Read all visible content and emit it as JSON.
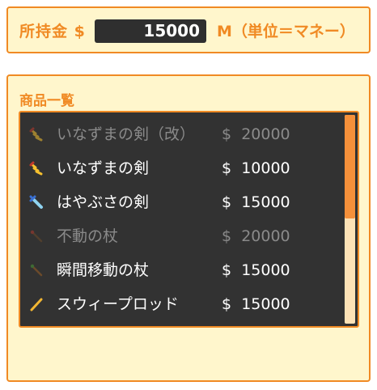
{
  "wallet": {
    "label": "所持金 $",
    "amount": "15000",
    "unit": "M（単位＝マネー）"
  },
  "shop": {
    "title": "商品一覧",
    "scroll_position": 0.0,
    "items": [
      {
        "name": "いなずまの剣（改）",
        "currency": "$",
        "price": "20000",
        "affordable": false,
        "icon": "lightning-sword-icon"
      },
      {
        "name": "いなずまの剣",
        "currency": "$",
        "price": "10000",
        "affordable": true,
        "icon": "lightning-sword-icon"
      },
      {
        "name": "はやぶさの剣",
        "currency": "$",
        "price": "15000",
        "affordable": true,
        "icon": "falcon-sword-icon"
      },
      {
        "name": "不動の杖",
        "currency": "$",
        "price": "20000",
        "affordable": false,
        "icon": "staff-icon"
      },
      {
        "name": "瞬間移動の杖",
        "currency": "$",
        "price": "15000",
        "affordable": true,
        "icon": "staff-icon"
      },
      {
        "name": "スウィープロッド",
        "currency": "$",
        "price": "15000",
        "affordable": true,
        "icon": "rod-icon"
      }
    ]
  },
  "colors": {
    "accent": "#f08a24",
    "panel_bg": "#fff6cc",
    "list_bg": "#323232",
    "enabled_text": "#ffffff",
    "disabled_text": "#8a8a8a"
  }
}
